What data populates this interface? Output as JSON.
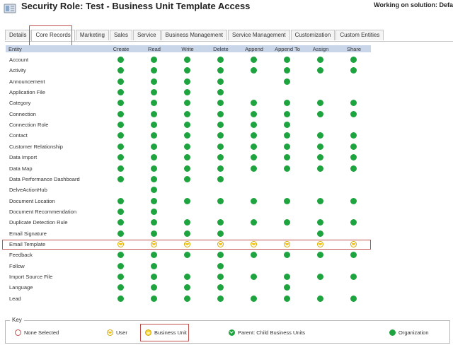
{
  "header": {
    "title": "Security Role: Test - Business Unit Template Access",
    "solution": "Working on solution: Defa"
  },
  "tabs": [
    {
      "label": "Details",
      "active": false
    },
    {
      "label": "Core Records",
      "active": true
    },
    {
      "label": "Marketing",
      "active": false
    },
    {
      "label": "Sales",
      "active": false
    },
    {
      "label": "Service",
      "active": false
    },
    {
      "label": "Business Management",
      "active": false
    },
    {
      "label": "Service Management",
      "active": false
    },
    {
      "label": "Customization",
      "active": false
    },
    {
      "label": "Custom Entities",
      "active": false
    }
  ],
  "grid": {
    "entity_header": "Entity",
    "columns": [
      "Create",
      "Read",
      "Write",
      "Delete",
      "Append",
      "Append To",
      "Assign",
      "Share"
    ],
    "rows": [
      {
        "name": "Account",
        "levels": [
          "org",
          "org",
          "org",
          "org",
          "org",
          "org",
          "org",
          "org"
        ]
      },
      {
        "name": "Activity",
        "levels": [
          "org",
          "org",
          "org",
          "org",
          "org",
          "org",
          "org",
          "org"
        ]
      },
      {
        "name": "Announcement",
        "levels": [
          "org",
          "org",
          "org",
          "org",
          "",
          "org",
          "",
          ""
        ]
      },
      {
        "name": "Application File",
        "levels": [
          "org",
          "org",
          "org",
          "org",
          "",
          "",
          "",
          ""
        ]
      },
      {
        "name": "Category",
        "levels": [
          "org",
          "org",
          "org",
          "org",
          "org",
          "org",
          "org",
          "org"
        ]
      },
      {
        "name": "Connection",
        "levels": [
          "org",
          "org",
          "org",
          "org",
          "org",
          "org",
          "org",
          "org"
        ]
      },
      {
        "name": "Connection Role",
        "levels": [
          "org",
          "org",
          "org",
          "org",
          "org",
          "org",
          "",
          ""
        ]
      },
      {
        "name": "Contact",
        "levels": [
          "org",
          "org",
          "org",
          "org",
          "org",
          "org",
          "org",
          "org"
        ]
      },
      {
        "name": "Customer Relationship",
        "levels": [
          "org",
          "org",
          "org",
          "org",
          "org",
          "org",
          "org",
          "org"
        ]
      },
      {
        "name": "Data Import",
        "levels": [
          "org",
          "org",
          "org",
          "org",
          "org",
          "org",
          "org",
          "org"
        ]
      },
      {
        "name": "Data Map",
        "levels": [
          "org",
          "org",
          "org",
          "org",
          "org",
          "org",
          "org",
          "org"
        ]
      },
      {
        "name": "Data Performance Dashboard",
        "levels": [
          "org",
          "org",
          "org",
          "org",
          "",
          "",
          "",
          ""
        ]
      },
      {
        "name": "DelveActionHub",
        "levels": [
          "",
          "org",
          "",
          "",
          "",
          "",
          "",
          ""
        ]
      },
      {
        "name": "Document Location",
        "levels": [
          "org",
          "org",
          "org",
          "org",
          "org",
          "org",
          "org",
          "org"
        ]
      },
      {
        "name": "Document Recommendation",
        "levels": [
          "org",
          "org",
          "",
          "",
          "",
          "",
          "",
          ""
        ]
      },
      {
        "name": "Duplicate Detection Rule",
        "levels": [
          "org",
          "org",
          "org",
          "org",
          "org",
          "org",
          "org",
          "org"
        ]
      },
      {
        "name": "Email Signature",
        "levels": [
          "org",
          "org",
          "org",
          "org",
          "",
          "",
          "org",
          ""
        ]
      },
      {
        "name": "Email Template",
        "levels": [
          "user",
          "user",
          "user",
          "user",
          "user",
          "user",
          "user",
          "user"
        ]
      },
      {
        "name": "Feedback",
        "levels": [
          "org",
          "org",
          "org",
          "org",
          "org",
          "org",
          "org",
          "org"
        ]
      },
      {
        "name": "Follow",
        "levels": [
          "org",
          "org",
          "",
          "org",
          "",
          "",
          "",
          ""
        ]
      },
      {
        "name": "Import Source File",
        "levels": [
          "org",
          "org",
          "org",
          "org",
          "org",
          "org",
          "org",
          "org"
        ]
      },
      {
        "name": "Language",
        "levels": [
          "org",
          "org",
          "org",
          "org",
          "",
          "org",
          "",
          ""
        ]
      },
      {
        "name": "Lead",
        "levels": [
          "org",
          "org",
          "org",
          "org",
          "org",
          "org",
          "org",
          "org"
        ]
      }
    ]
  },
  "key": {
    "title": "Key",
    "none": "None Selected",
    "user": "User",
    "business_unit": "Business Unit",
    "parent": "Parent: Child Business Units",
    "organization": "Organization"
  },
  "colors": {
    "organization": "#1ea43f",
    "user": "#f2c418",
    "header_bg": "#c9d6ea",
    "highlight": "#c0504d"
  }
}
